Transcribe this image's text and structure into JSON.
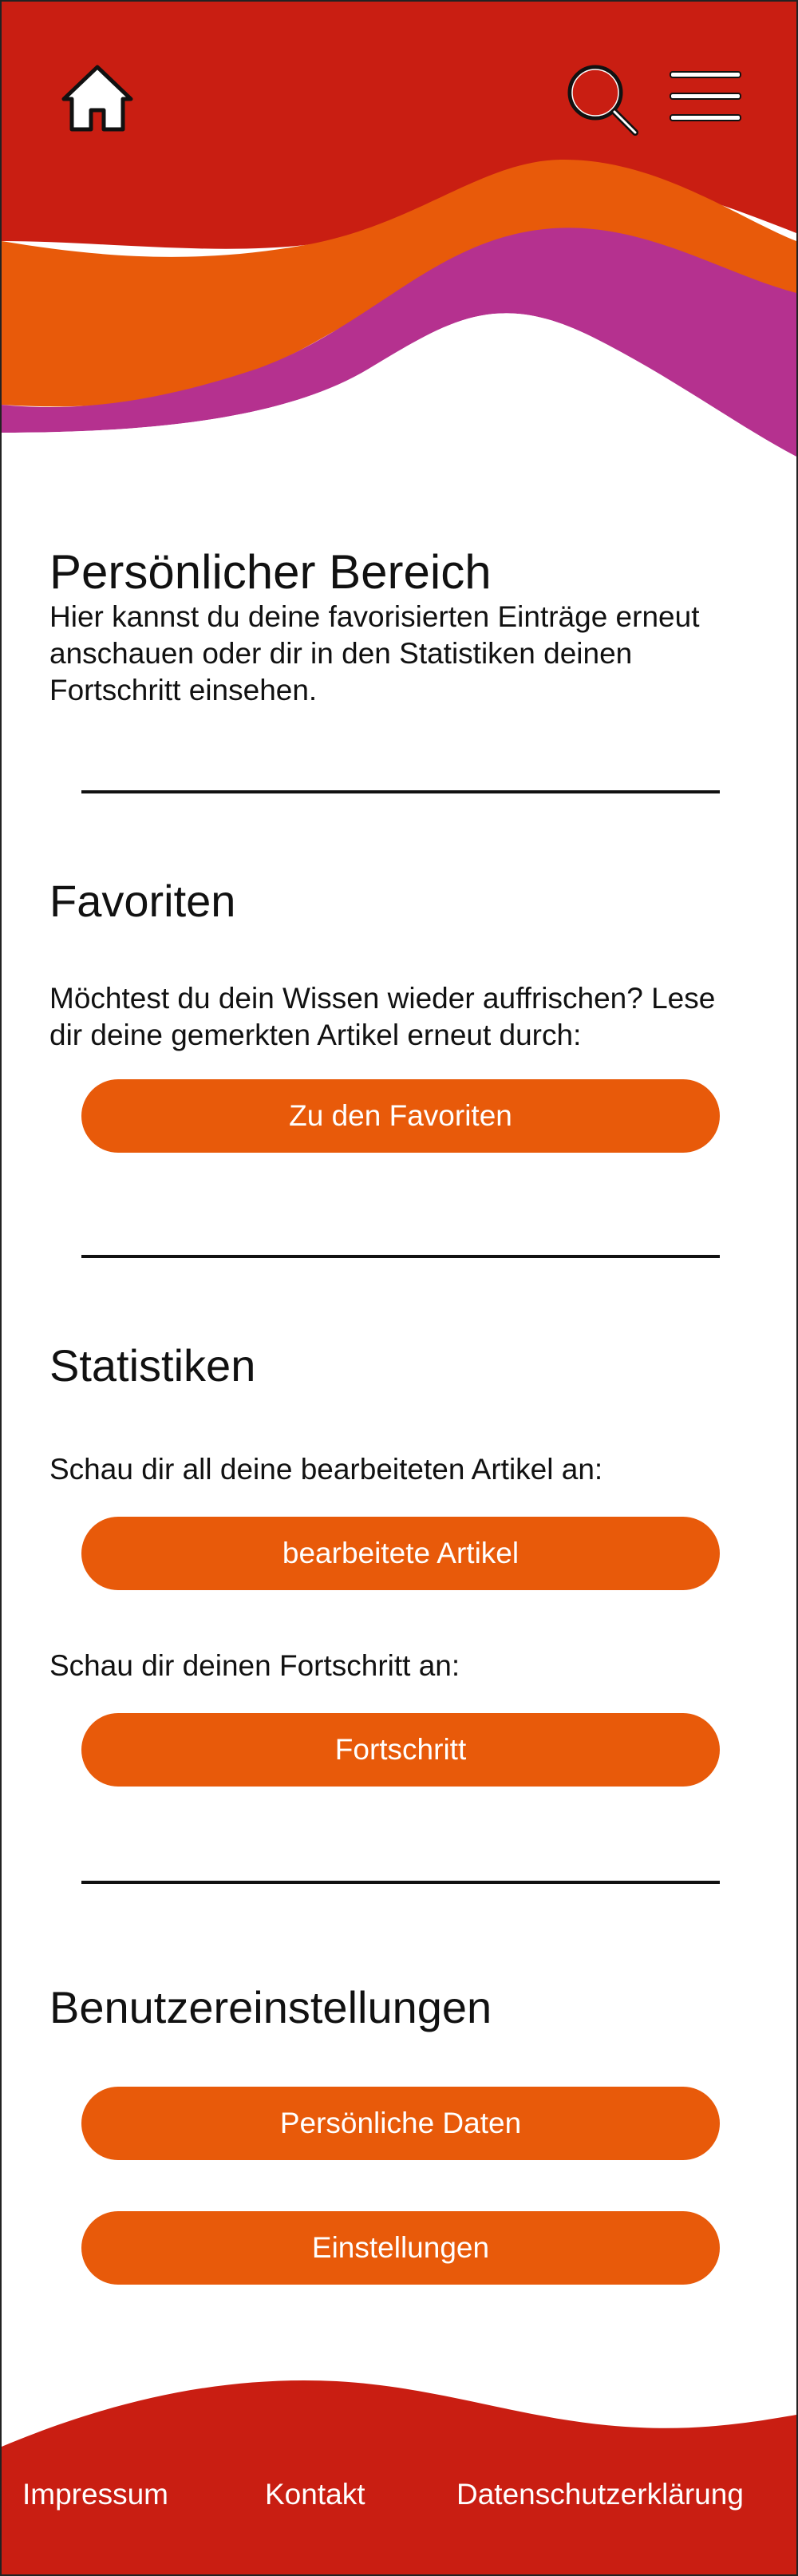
{
  "header": {
    "home_icon": "home-icon",
    "search_icon": "search-icon",
    "menu_icon": "hamburger-menu-icon",
    "colors": {
      "red": "#c91e12",
      "orange": "#e85a0a",
      "magenta": "#b5318f"
    }
  },
  "intro": {
    "title": "Persönlicher Bereich",
    "text": "Hier kannst du deine favorisierten Einträge erneut anschauen oder dir in den Statistiken deinen Fortschritt einsehen."
  },
  "favorites": {
    "title": "Favoriten",
    "text": "Möchtest du dein Wissen wieder auffrischen? Lese dir deine gemerkten Artikel erneut durch:",
    "button": "Zu den Favoriten"
  },
  "statistics": {
    "title": "Statistiken",
    "articles_text": "Schau dir all deine bearbeiteten Artikel an:",
    "articles_button": "bearbeitete Artikel",
    "progress_text": "Schau dir deinen Fortschritt an:",
    "progress_button": "Fortschritt"
  },
  "user_settings": {
    "title": "Benutzereinstellungen",
    "personal_data_button": "Persönliche Daten",
    "settings_button": "Einstellungen"
  },
  "footer": {
    "impressum": "Impressum",
    "kontakt": "Kontakt",
    "datenschutz": "Datenschutzerklärung"
  }
}
